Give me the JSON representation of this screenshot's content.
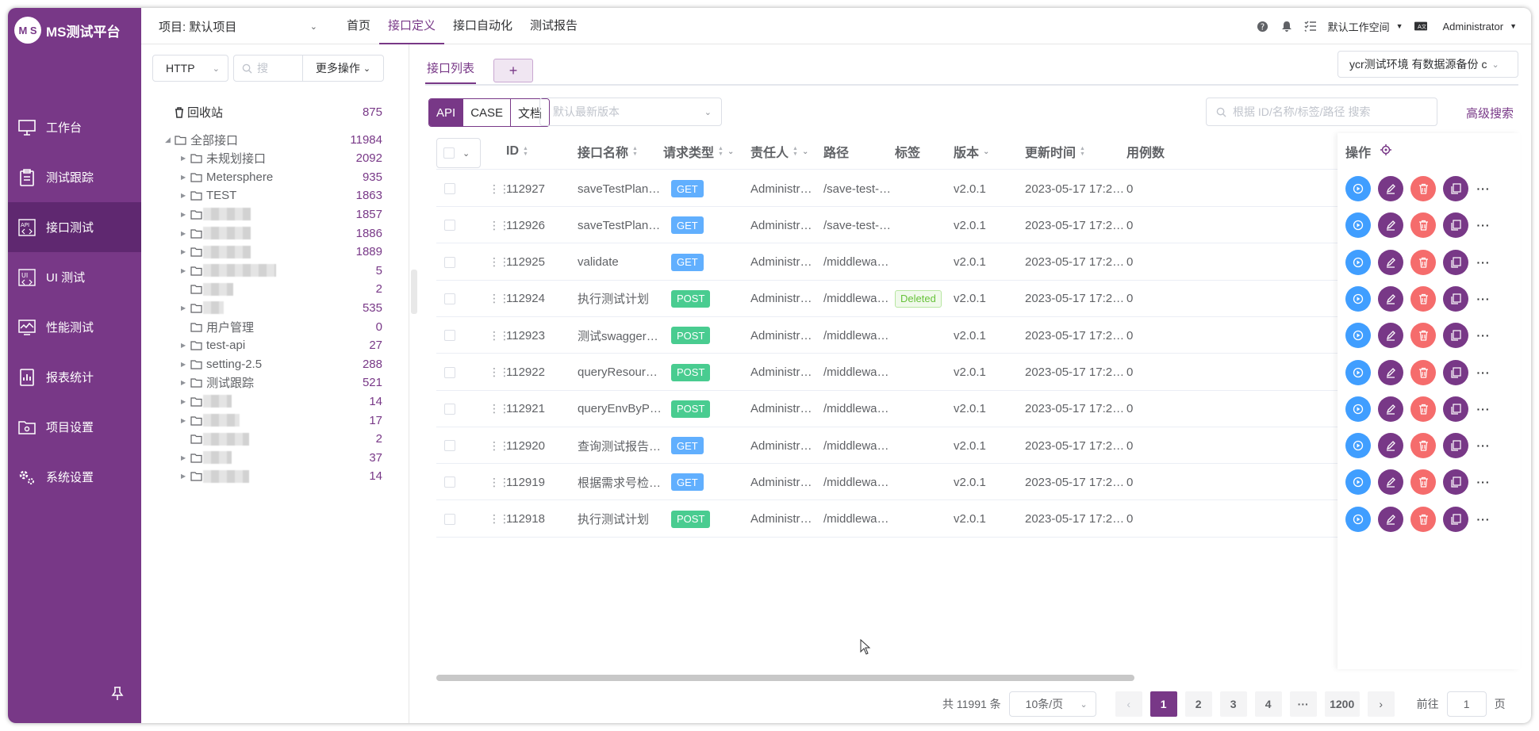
{
  "app": {
    "logo_mark": "M S",
    "logo_text": "MS测试平台"
  },
  "sidebar": {
    "items": [
      {
        "label": "工作台",
        "icon": "monitor-icon"
      },
      {
        "label": "测试跟踪",
        "icon": "clipboard-icon"
      },
      {
        "label": "接口测试",
        "icon": "api-icon",
        "active": true
      },
      {
        "label": "UI 测试",
        "icon": "ui-test-icon"
      },
      {
        "label": "性能测试",
        "icon": "performance-icon"
      },
      {
        "label": "报表统计",
        "icon": "report-icon"
      },
      {
        "label": "项目设置",
        "icon": "folder-settings-icon"
      },
      {
        "label": "系统设置",
        "icon": "gears-icon"
      }
    ]
  },
  "topbar": {
    "project": "项目: 默认项目",
    "menu": [
      "首页",
      "接口定义",
      "接口自动化",
      "测试报告"
    ],
    "active_menu": "接口定义",
    "workspace": "默认工作空间",
    "user": "Administrator"
  },
  "tree_toolbar": {
    "protocol": "HTTP",
    "search_placeholder": "搜",
    "more": "更多操作"
  },
  "tree": {
    "recycle": {
      "label": "回收站",
      "count": "875"
    },
    "root": {
      "label": "全部接口",
      "count": "11984"
    },
    "nodes": [
      {
        "label": "未规划接口",
        "count": "2092",
        "expandable": true
      },
      {
        "label": "Metersphere",
        "count": "935",
        "expandable": true
      },
      {
        "label": "TEST",
        "count": "1863",
        "expandable": true
      },
      {
        "label": "",
        "count": "1857",
        "expandable": true,
        "blur": 60
      },
      {
        "label": "",
        "count": "1886",
        "expandable": true,
        "blur": 60
      },
      {
        "label": "",
        "count": "1889",
        "expandable": true,
        "blur": 60
      },
      {
        "label": "",
        "count": "5",
        "expandable": true,
        "blur": 92
      },
      {
        "label": "",
        "count": "2",
        "expandable": false,
        "blur": 38
      },
      {
        "label": "",
        "count": "535",
        "expandable": true,
        "blur": 26
      },
      {
        "label": "用户管理",
        "count": "0",
        "expandable": false
      },
      {
        "label": "test-api",
        "count": "27",
        "expandable": true
      },
      {
        "label": "setting-2.5",
        "count": "288",
        "expandable": true
      },
      {
        "label": "测试跟踪",
        "count": "521",
        "expandable": true
      },
      {
        "label": "",
        "count": "14",
        "expandable": true,
        "blur": 36
      },
      {
        "label": "",
        "count": "17",
        "expandable": true,
        "blur": 46
      },
      {
        "label": "",
        "count": "2",
        "expandable": false,
        "blur": 58
      },
      {
        "label": "",
        "count": "37",
        "expandable": true,
        "blur": 36
      },
      {
        "label": "",
        "count": "14",
        "expandable": true,
        "blur": 58
      }
    ]
  },
  "tabs": {
    "list": "接口列表",
    "add": "+"
  },
  "env": "ycr测试环境 有数据源备份 c",
  "modes": [
    "API",
    "CASE",
    "文档"
  ],
  "version_placeholder": "默认最新版本",
  "search_placeholder": "根据 ID/名称/标签/路径 搜索",
  "advanced_search": "高级搜索",
  "columns": [
    "ID",
    "接口名称",
    "请求类型",
    "责任人",
    "路径",
    "标签",
    "版本",
    "更新时间",
    "用例数",
    "操作"
  ],
  "rows": [
    {
      "id": "112927",
      "name": "saveTestPlan…",
      "method": "GET",
      "owner": "Administr…",
      "path": "/save-test-…",
      "tag": "",
      "version": "v2.0.1",
      "updated": "2023-05-17 17:2…",
      "cases": "0"
    },
    {
      "id": "112926",
      "name": "saveTestPlan…",
      "method": "GET",
      "owner": "Administr…",
      "path": "/save-test-…",
      "tag": "",
      "version": "v2.0.1",
      "updated": "2023-05-17 17:2…",
      "cases": "0"
    },
    {
      "id": "112925",
      "name": "validate",
      "method": "GET",
      "owner": "Administr…",
      "path": "/middlewa…",
      "tag": "",
      "version": "v2.0.1",
      "updated": "2023-05-17 17:2…",
      "cases": "0"
    },
    {
      "id": "112924",
      "name": "执行测试计划",
      "method": "POST",
      "owner": "Administr…",
      "path": "/middlewa…",
      "tag": "Deleted",
      "version": "v2.0.1",
      "updated": "2023-05-17 17:2…",
      "cases": "0"
    },
    {
      "id": "112923",
      "name": "测试swagger…",
      "method": "POST",
      "owner": "Administr…",
      "path": "/middlewa…",
      "tag": "",
      "version": "v2.0.1",
      "updated": "2023-05-17 17:2…",
      "cases": "0"
    },
    {
      "id": "112922",
      "name": "queryResour…",
      "method": "POST",
      "owner": "Administr…",
      "path": "/middlewa…",
      "tag": "",
      "version": "v2.0.1",
      "updated": "2023-05-17 17:2…",
      "cases": "0"
    },
    {
      "id": "112921",
      "name": "queryEnvByP…",
      "method": "POST",
      "owner": "Administr…",
      "path": "/middlewa…",
      "tag": "",
      "version": "v2.0.1",
      "updated": "2023-05-17 17:2…",
      "cases": "0"
    },
    {
      "id": "112920",
      "name": "查询测试报告…",
      "method": "GET",
      "owner": "Administr…",
      "path": "/middlewa…",
      "tag": "",
      "version": "v2.0.1",
      "updated": "2023-05-17 17:2…",
      "cases": "0"
    },
    {
      "id": "112919",
      "name": "根据需求号检…",
      "method": "GET",
      "owner": "Administr…",
      "path": "/middlewa…",
      "tag": "",
      "version": "v2.0.1",
      "updated": "2023-05-17 17:2…",
      "cases": "0"
    },
    {
      "id": "112918",
      "name": "执行测试计划",
      "method": "POST",
      "owner": "Administr…",
      "path": "/middlewa…",
      "tag": "",
      "version": "v2.0.1",
      "updated": "2023-05-17 17:2…",
      "cases": "0"
    }
  ],
  "pagination": {
    "total": "共 11991 条",
    "page_size": "10条/页",
    "pages": [
      "1",
      "2",
      "3",
      "4",
      "···",
      "1200"
    ],
    "current": "1",
    "goto_prefix": "前往",
    "goto_value": "1",
    "goto_suffix": "页"
  },
  "colors": {
    "brand": "#783887",
    "get": "#61affe",
    "post": "#49cc90",
    "run": "#409eff",
    "delete": "#f56c6c"
  }
}
